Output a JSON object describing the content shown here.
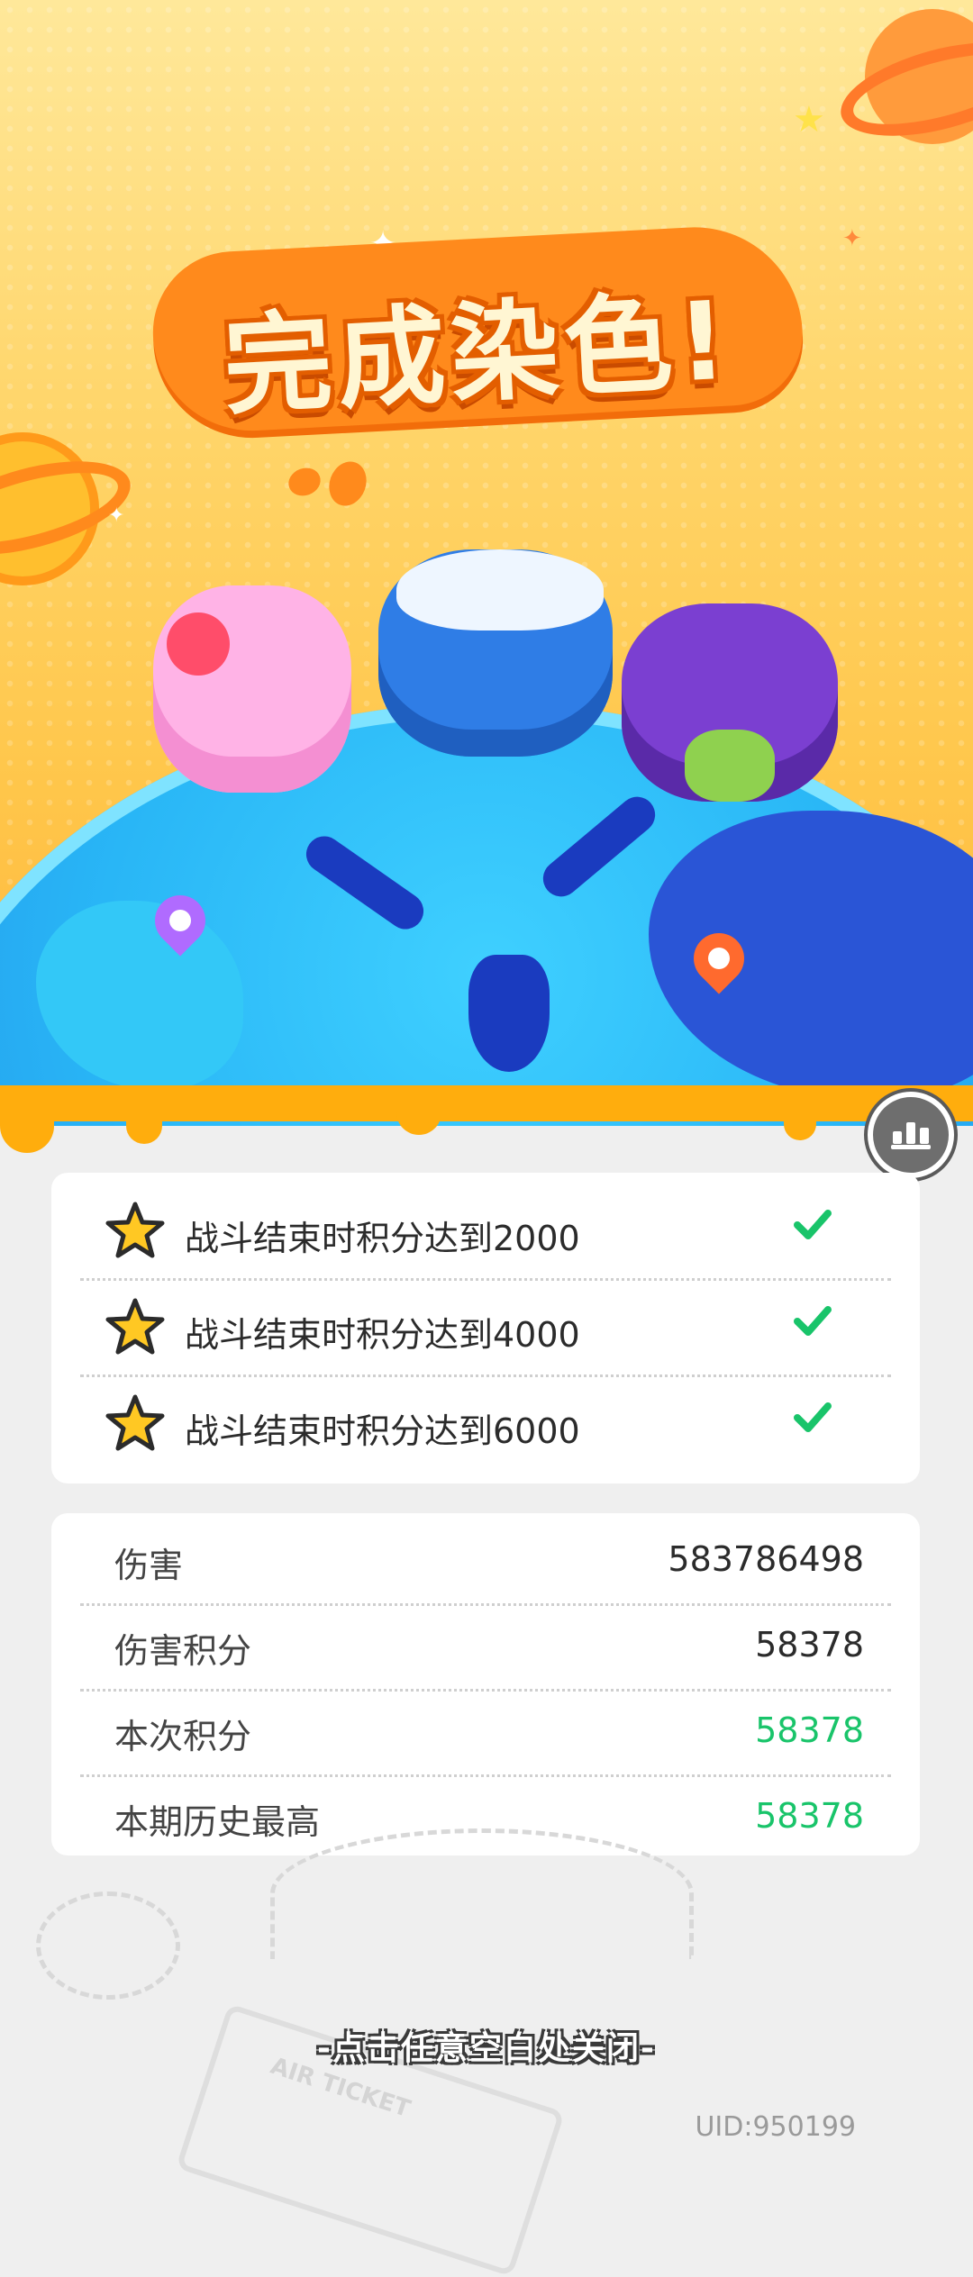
{
  "banner": {
    "title": "完成染色!"
  },
  "goals": [
    {
      "text": "战斗结束时积分达到2000",
      "completed": true
    },
    {
      "text": "战斗结束时积分达到4000",
      "completed": true
    },
    {
      "text": "战斗结束时积分达到6000",
      "completed": true
    }
  ],
  "stats": [
    {
      "label": "伤害",
      "value": "583786498",
      "highlight": false
    },
    {
      "label": "伤害积分",
      "value": "58378",
      "highlight": false
    },
    {
      "label": "本次积分",
      "value": "58378",
      "highlight": true
    },
    {
      "label": "本期历史最高",
      "value": "58378",
      "highlight": true
    }
  ],
  "footer": {
    "close_hint": "-点击任意空白处关闭-",
    "uid": "UID:950199",
    "ticket_text": "AIR TICKET"
  },
  "icons": {
    "goal": "star-icon",
    "status": "check-icon",
    "ranking": "ranking-icon"
  },
  "colors": {
    "accent_orange": "#ff8a1c",
    "check_green": "#19c46a",
    "goal_star": "#ffc823"
  }
}
